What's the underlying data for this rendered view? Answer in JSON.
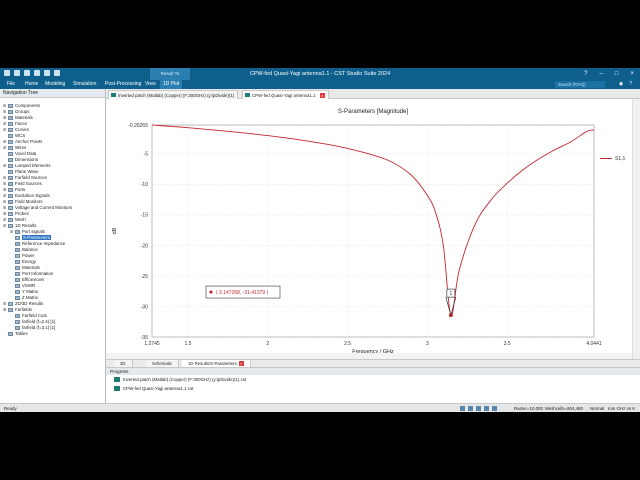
{
  "window": {
    "title": "CPW-fed Quasi-Yagi antenna1.1 - CST Studio Suite 2024",
    "context_tab": "Result To"
  },
  "menu": {
    "items": [
      "File",
      "Home",
      "Modeling",
      "Simulation",
      "Post-Processing",
      "View",
      "1D Plot"
    ],
    "active": "1D Plot",
    "search_placeholder": "Search (F3+Q)"
  },
  "nav": {
    "header": "Navigation Tree",
    "items": [
      "Components",
      "Groups",
      "Materials",
      "Faces",
      "Curves",
      "WCS",
      "Anchor Points",
      "Wires",
      "Voxel Data",
      "Dimensions",
      "Lumped Elements",
      "Plane Wave",
      "Farfield Sources",
      "Field Sources",
      "Ports",
      "Excitation Signals",
      "Field Monitors",
      "Voltage and Current Monitors",
      "Probes",
      "Mesh",
      "1D Results",
      "Port signals",
      "S-Parameters",
      "Reference Impedance",
      "Balance",
      "Power",
      "Energy",
      "Materials",
      "Port Information",
      "Efficiencies",
      "VSWR",
      "Y Matrix",
      "Z Matrix",
      "2D/3D Results",
      "Farfields",
      "Farfield Cuts",
      "farfield (f=2.4) [1]",
      "farfield (f=3.1) [1]",
      "Tables"
    ],
    "selected": "S-Parameters"
  },
  "tabs": [
    {
      "label": "Inverted patch (Matlab) (Copper) (F:300GHz) (y:lpDivide)(1)"
    },
    {
      "label": "CPW-fed Quasi-Yagi antenna1.1"
    }
  ],
  "bottom_tabs": [
    "3D",
    "Schematic",
    "1D Results\\S-Parameters"
  ],
  "progress": {
    "header": "Progress",
    "items": [
      "Inverted patch (Matlab) (Copper) (F:300GHz) (y:lpDivide)(1).cst",
      "CPW-fed Quasi-Yagi antenna1.1.cst"
    ]
  },
  "status": {
    "left": "Ready",
    "raster": "Raster=10.000",
    "meshcells": "Meshcells=604,480",
    "mode": "Normal",
    "units": "mm  GHz  ns  K"
  },
  "chart_data": {
    "type": "line",
    "title": "S-Parameters [Magnitude]",
    "xlabel": "Frequency / GHz",
    "ylabel": "dB",
    "xlim": [
      1.2745,
      4.0441
    ],
    "ylim": [
      -35,
      -0.26265
    ],
    "x_ticks": [
      "1.2745",
      "1.5",
      "2",
      "2.5",
      "3",
      "3.5",
      "4.0441"
    ],
    "y_ticks": [
      "-0.26265",
      "-5",
      "-10",
      "-15",
      "-20",
      "-25",
      "-30",
      "-35"
    ],
    "series": [
      {
        "name": "S1,1",
        "color": "#c4262e",
        "x": [
          1.2745,
          1.5,
          1.75,
          2.0,
          2.25,
          2.5,
          2.75,
          2.9,
          3.0,
          3.05,
          3.1,
          3.1473,
          3.2,
          3.3,
          3.4,
          3.5,
          3.6,
          3.7,
          3.8,
          3.9,
          4.0,
          4.0441
        ],
        "y": [
          -0.26,
          -0.7,
          -1.3,
          -2.0,
          -2.9,
          -4.1,
          -6.0,
          -8.5,
          -11.8,
          -14.5,
          -20.0,
          -31.41,
          -24.0,
          -16.5,
          -12.5,
          -9.8,
          -7.6,
          -5.8,
          -4.3,
          -3.0,
          -1.3,
          -1.1
        ]
      }
    ],
    "marker": {
      "label": "1",
      "x": 3.147268,
      "y": -31.41379,
      "readout": "( 3.147268, -31.41379 )"
    },
    "grid": true,
    "legend_position": "right"
  }
}
